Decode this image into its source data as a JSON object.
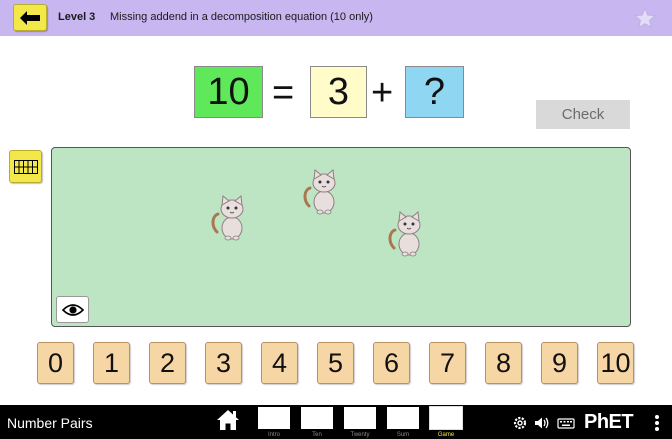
{
  "header": {
    "level_title": "Level 3",
    "level_description": "Missing addend in a decomposition equation (10 only)",
    "back_icon": "arrow-left-icon",
    "star_icon": "star-icon"
  },
  "equation": {
    "sum": "10",
    "equals": "=",
    "addend_a": "3",
    "plus": "+",
    "addend_b": "?"
  },
  "check_button": "Check",
  "play_area": {
    "cat_count": 3,
    "grid_tool_icon": "ten-frame-icon",
    "eye_icon": "eye-icon"
  },
  "number_keys": [
    "0",
    "1",
    "2",
    "3",
    "4",
    "5",
    "6",
    "7",
    "8",
    "9",
    "10"
  ],
  "footer": {
    "sim_title": "Number Pairs",
    "screens": [
      {
        "label": "Intro",
        "active": false
      },
      {
        "label": "Ten",
        "active": false
      },
      {
        "label": "Twenty",
        "active": false
      },
      {
        "label": "Sum",
        "active": false
      },
      {
        "label": "Game",
        "active": true
      }
    ],
    "logo": "PhET"
  },
  "colors": {
    "header_bg": "#c7b6ef",
    "sum_box": "#5fe85a",
    "addend_box": "#fffcc9",
    "missing_box": "#8fd6f3",
    "play_area": "#bde5c3",
    "number_key": "#f7d6a5",
    "tool_yellow": "#f3e84a"
  }
}
